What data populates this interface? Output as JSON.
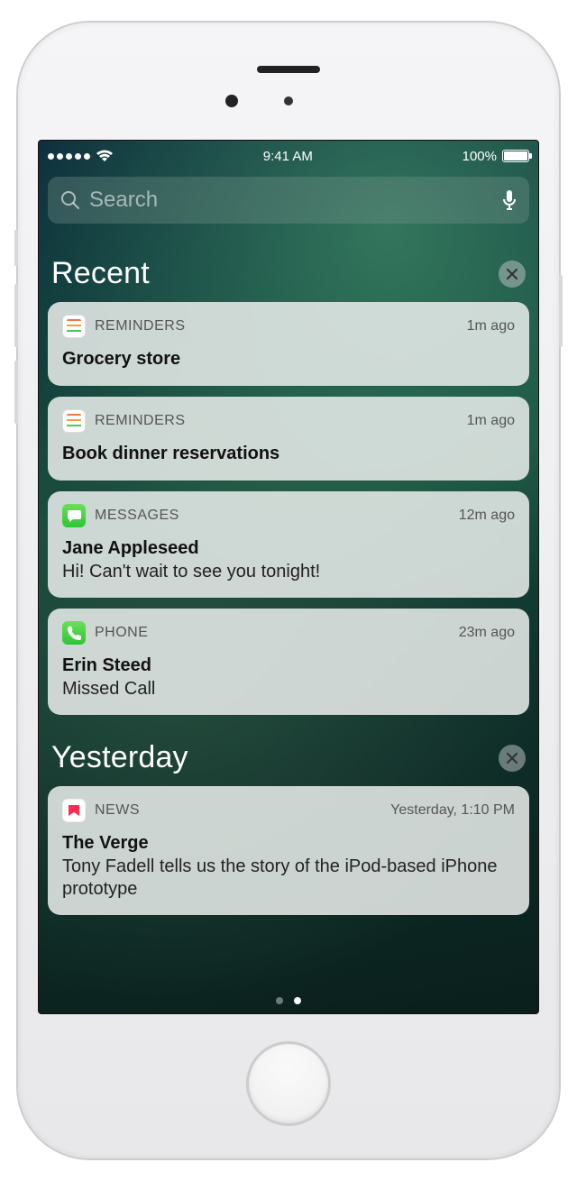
{
  "status": {
    "time": "9:41 AM",
    "battery_pct": "100%"
  },
  "search": {
    "placeholder": "Search"
  },
  "sections": [
    {
      "title": "Recent",
      "items": [
        {
          "app": "REMINDERS",
          "icon": "reminders",
          "time": "1m ago",
          "title": "Grocery store",
          "body": ""
        },
        {
          "app": "REMINDERS",
          "icon": "reminders",
          "time": "1m ago",
          "title": "Book dinner reservations",
          "body": ""
        },
        {
          "app": "MESSAGES",
          "icon": "messages",
          "time": "12m ago",
          "title": "Jane Appleseed",
          "body": "Hi! Can't wait to see you tonight!"
        },
        {
          "app": "PHONE",
          "icon": "phone",
          "time": "23m ago",
          "title": "Erin Steed",
          "body": "Missed Call"
        }
      ]
    },
    {
      "title": "Yesterday",
      "items": [
        {
          "app": "NEWS",
          "icon": "news",
          "time": "Yesterday, 1:10 PM",
          "title": "The Verge",
          "body": "Tony Fadell tells us the story of the iPod-based iPhone prototype"
        }
      ]
    }
  ]
}
